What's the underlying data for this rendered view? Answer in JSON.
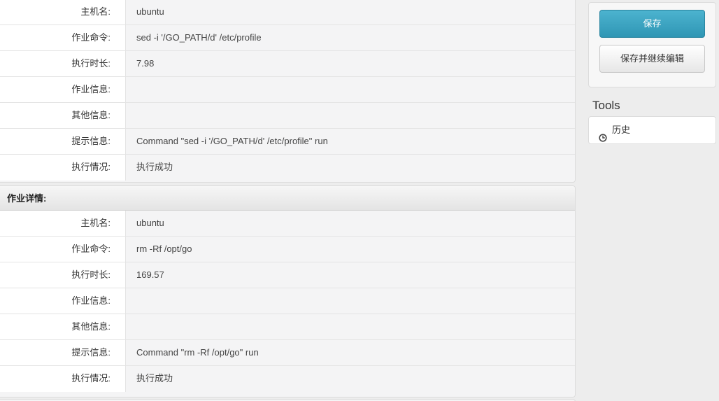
{
  "job_blocks": [
    {
      "header": "",
      "rows": [
        {
          "label": "主机名:",
          "value": "ubuntu"
        },
        {
          "label": "作业命令:",
          "value": "sed -i '/GO_PATH/d' /etc/profile"
        },
        {
          "label": "执行时长:",
          "value": "7.98"
        },
        {
          "label": "作业信息:",
          "value": ""
        },
        {
          "label": "其他信息:",
          "value": ""
        },
        {
          "label": "提示信息:",
          "value": "Command \"sed -i '/GO_PATH/d' /etc/profile\" run"
        },
        {
          "label": "执行情况:",
          "value": "执行成功"
        }
      ]
    },
    {
      "header": "作业详情:",
      "rows": [
        {
          "label": "主机名:",
          "value": "ubuntu"
        },
        {
          "label": "作业命令:",
          "value": "rm -Rf /opt/go"
        },
        {
          "label": "执行时长:",
          "value": "169.57"
        },
        {
          "label": "作业信息:",
          "value": ""
        },
        {
          "label": "其他信息:",
          "value": ""
        },
        {
          "label": "提示信息:",
          "value": "Command \"rm -Rf /opt/go\" run"
        },
        {
          "label": "执行情况:",
          "value": "执行成功"
        }
      ]
    }
  ],
  "sidebar": {
    "save_label": "保存",
    "save_continue_label": "保存并继续编辑",
    "tools_title": "Tools",
    "tools": [
      {
        "label": "历史",
        "icon": "clock-icon"
      }
    ]
  },
  "colors": {
    "primary_button": "#2f96b4",
    "panel_bg": "#f4f4f5",
    "page_bg": "#ededed"
  }
}
